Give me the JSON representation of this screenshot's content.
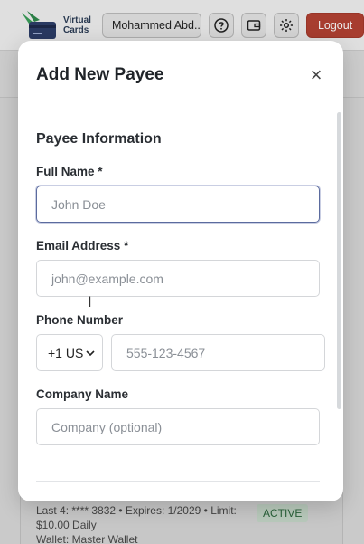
{
  "header": {
    "logo_line1": "Virtual",
    "logo_line2": "Cards",
    "user_name": "Mohammed Abd...",
    "help_icon": "help-circle-icon",
    "wallet_icon": "wallet-icon",
    "settings_icon": "gear-icon",
    "logout_label": "Logout"
  },
  "background_card": {
    "details": "Last 4: **** 3832 • Expires: 1/2029 • Limit: $10.00 Daily",
    "wallet": "Wallet: Master Wallet",
    "status": "ACTIVE"
  },
  "modal": {
    "title": "Add New Payee",
    "close_label": "×",
    "section_title": "Payee Information",
    "fields": {
      "full_name": {
        "label": "Full Name *",
        "placeholder": "John Doe",
        "value": ""
      },
      "email": {
        "label": "Email Address *",
        "placeholder": "john@example.com",
        "value": ""
      },
      "phone": {
        "label": "Phone Number",
        "country_code": "+1 US",
        "placeholder": "555-123-4567",
        "value": ""
      },
      "company": {
        "label": "Company Name",
        "placeholder": "Company (optional)",
        "value": ""
      }
    }
  },
  "colors": {
    "logout": "#b64333",
    "focus_border": "#5b6b9e",
    "badge_text": "#2d6a3e"
  }
}
